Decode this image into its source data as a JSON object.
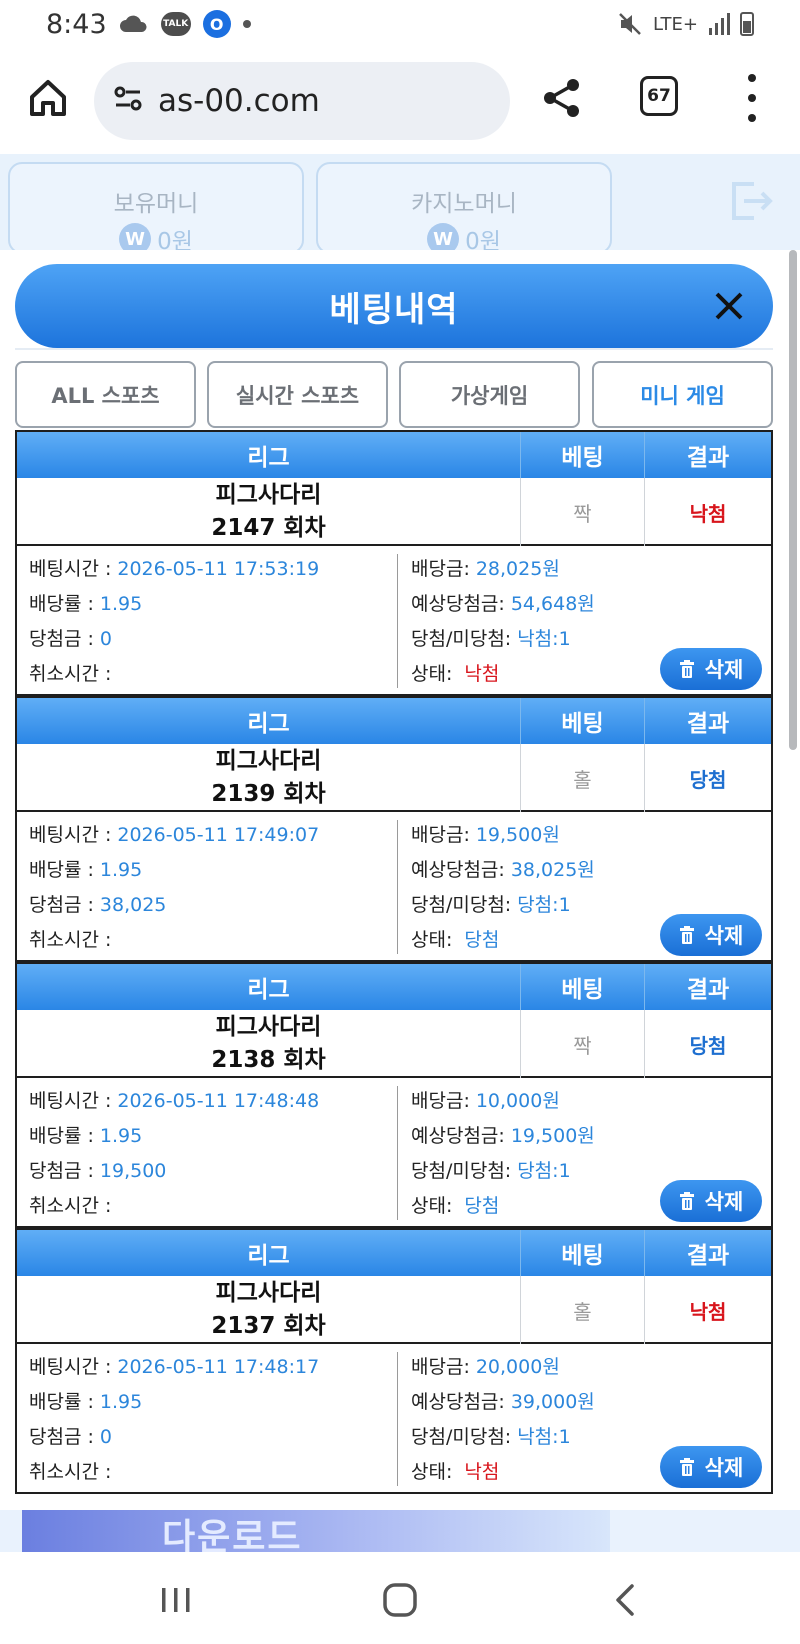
{
  "status_bar": {
    "time": "8:43",
    "talk_label": "TALK",
    "network_label": "LTE+"
  },
  "browser": {
    "url": "as-00.com",
    "tab_count": "67"
  },
  "wallet": {
    "cards": [
      {
        "label": "보유머니",
        "value": "0원",
        "currency_symbol": "W"
      },
      {
        "label": "카지노머니",
        "value": "0원",
        "currency_symbol": "W"
      }
    ]
  },
  "modal": {
    "title": "베팅내역",
    "tabs": [
      {
        "label": "ALL 스포츠",
        "active": false
      },
      {
        "label": "실시간 스포츠",
        "active": false
      },
      {
        "label": "가상게임",
        "active": false
      },
      {
        "label": "미니 게임",
        "active": true
      }
    ],
    "table_headers": {
      "league": "리그",
      "bet": "베팅",
      "result": "결과"
    },
    "labels": {
      "bet_time": "베팅시간 :",
      "odds": "배당률 :",
      "win_amount": "당첨금 :",
      "cancel_time": "취소시간 :",
      "stake": "배당금:",
      "expected_win": "예상당첨금:",
      "win_lose": "당첨/미당첨:",
      "status": "상태:",
      "delete": "삭제"
    },
    "bets": [
      {
        "game": "피그사다리",
        "round": "2147 회차",
        "pick": "짝",
        "result": "낙첨",
        "bet_time": "2026-05-11 17:53:19",
        "odds": "1.95",
        "win_amount": "0",
        "cancel_time": "",
        "stake": "28,025원",
        "expected_win": "54,648원",
        "win_lose": "낙첨:1",
        "status": "낙첨"
      },
      {
        "game": "피그사다리",
        "round": "2139 회차",
        "pick": "홀",
        "result": "당첨",
        "bet_time": "2026-05-11 17:49:07",
        "odds": "1.95",
        "win_amount": "38,025",
        "cancel_time": "",
        "stake": "19,500원",
        "expected_win": "38,025원",
        "win_lose": "당첨:1",
        "status": "당첨"
      },
      {
        "game": "피그사다리",
        "round": "2138 회차",
        "pick": "짝",
        "result": "당첨",
        "bet_time": "2026-05-11 17:48:48",
        "odds": "1.95",
        "win_amount": "19,500",
        "cancel_time": "",
        "stake": "10,000원",
        "expected_win": "19,500원",
        "win_lose": "당첨:1",
        "status": "당첨"
      },
      {
        "game": "피그사다리",
        "round": "2137 회차",
        "pick": "홀",
        "result": "낙첨",
        "bet_time": "2026-05-11 17:48:17",
        "odds": "1.95",
        "win_amount": "0",
        "cancel_time": "",
        "stake": "20,000원",
        "expected_win": "39,000원",
        "win_lose": "낙첨:1",
        "status": "낙첨"
      }
    ]
  },
  "banner": {
    "text": "다운로드"
  },
  "colors": {
    "accent_blue": "#2a86e6",
    "lose_red": "#d8151c",
    "win_blue": "#1e6fd0",
    "value_blue": "#2c86db"
  }
}
